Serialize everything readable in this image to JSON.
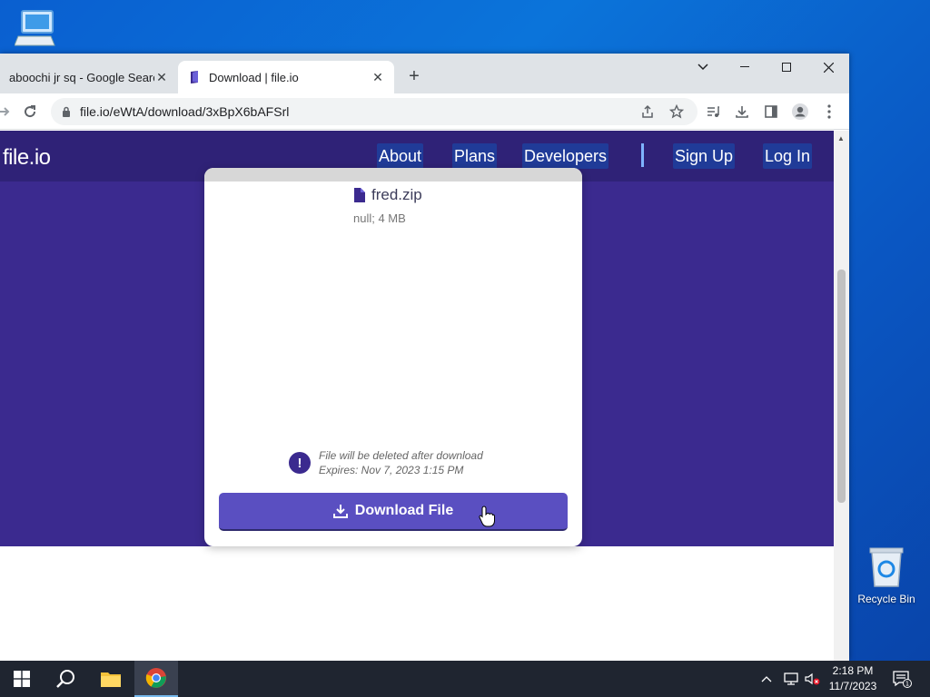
{
  "desktop": {
    "recycle_bin_label": "Recycle Bin"
  },
  "browser": {
    "tabs": [
      {
        "title": "aboochi jr sq - Google Search",
        "active": false
      },
      {
        "title": "Download | file.io",
        "active": true
      }
    ],
    "url": "file.io/eWtA/download/3xBpX6bAFSrl"
  },
  "site": {
    "logo": "file.io",
    "nav": {
      "about": "About",
      "plans": "Plans",
      "developers": "Developers",
      "sep": "|",
      "signup": "Sign Up",
      "login": "Log In"
    },
    "file": {
      "name": "fred.zip",
      "meta": "null; 4 MB"
    },
    "notice": {
      "line1": "File will be deleted after download",
      "line2": "Expires: Nov 7, 2023 1:15 PM"
    },
    "download_button": "Download File"
  },
  "taskbar": {
    "time": "2:18 PM",
    "date": "11/7/2023",
    "notification_count": "1"
  },
  "colors": {
    "brand_purple": "#3b2a8f",
    "header_purple": "#2f2277",
    "button_purple": "#5a4fc1"
  }
}
